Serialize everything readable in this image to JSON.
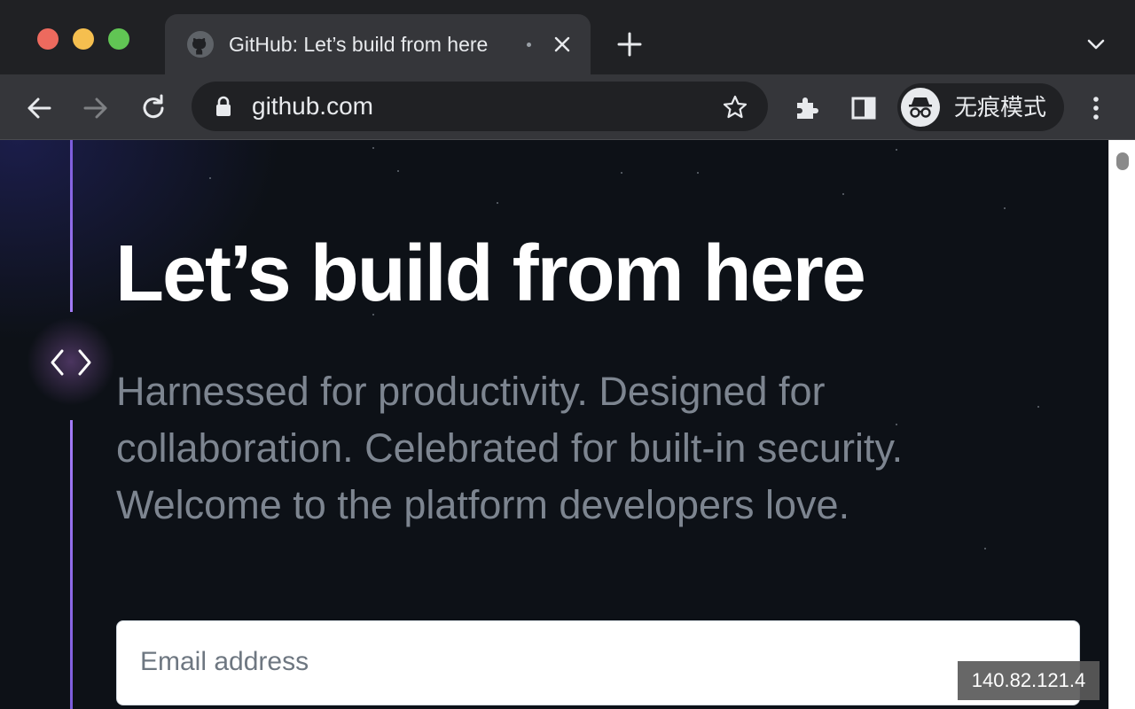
{
  "tab": {
    "title": "GitHub: Let’s build from here",
    "favicon": "github-icon"
  },
  "omnibox": {
    "url": "github.com"
  },
  "profile": {
    "label": "无痕模式",
    "icon": "incognito-icon"
  },
  "hero": {
    "title": "Let’s build from here",
    "subtitle": "Harnessed for productivity. Designed for collaboration. Celebrated for built-in security. Welcome to the platform developers love."
  },
  "signup": {
    "email_placeholder": "Email address"
  },
  "overlay": {
    "ip": "140.82.121.4"
  },
  "colors": {
    "accent_purple": "#a37bf7",
    "page_bg": "#0d1117",
    "chrome_bg": "#202124",
    "toolbar_bg": "#35363a"
  }
}
